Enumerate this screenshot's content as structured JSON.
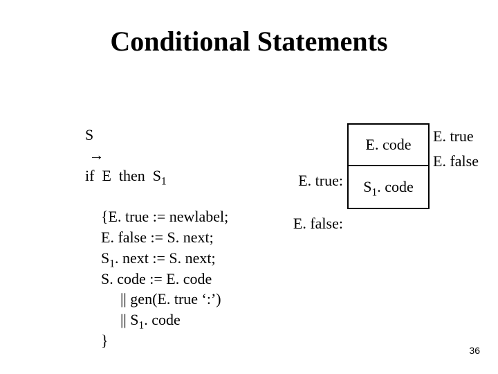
{
  "title": "Conditional Statements",
  "rule": {
    "lhs": "S",
    "arrow": "→",
    "rhs_pre": "if  E  then  S",
    "rhs_sub": "1"
  },
  "actions": {
    "l1": "{E. true := newlabel;",
    "l2": " E. false := S. next;",
    "l3_pre": " S",
    "l3_sub": "1",
    "l3_post": ". next := S. next;",
    "l4": " S. code := E. code",
    "l5": "|| gen(E. true ‘:’)",
    "l6_pre": "|| S",
    "l6_sub": "1",
    "l6_post": ". code",
    "l7": "}"
  },
  "diagram": {
    "box_top": "E. code",
    "box_bot_pre": "S",
    "box_bot_sub": "1",
    "box_bot_post": ". code",
    "left_true": "E. true:",
    "left_false": "E. false:",
    "right_true": "E. true",
    "right_false": "E. false"
  },
  "page_number": "36"
}
